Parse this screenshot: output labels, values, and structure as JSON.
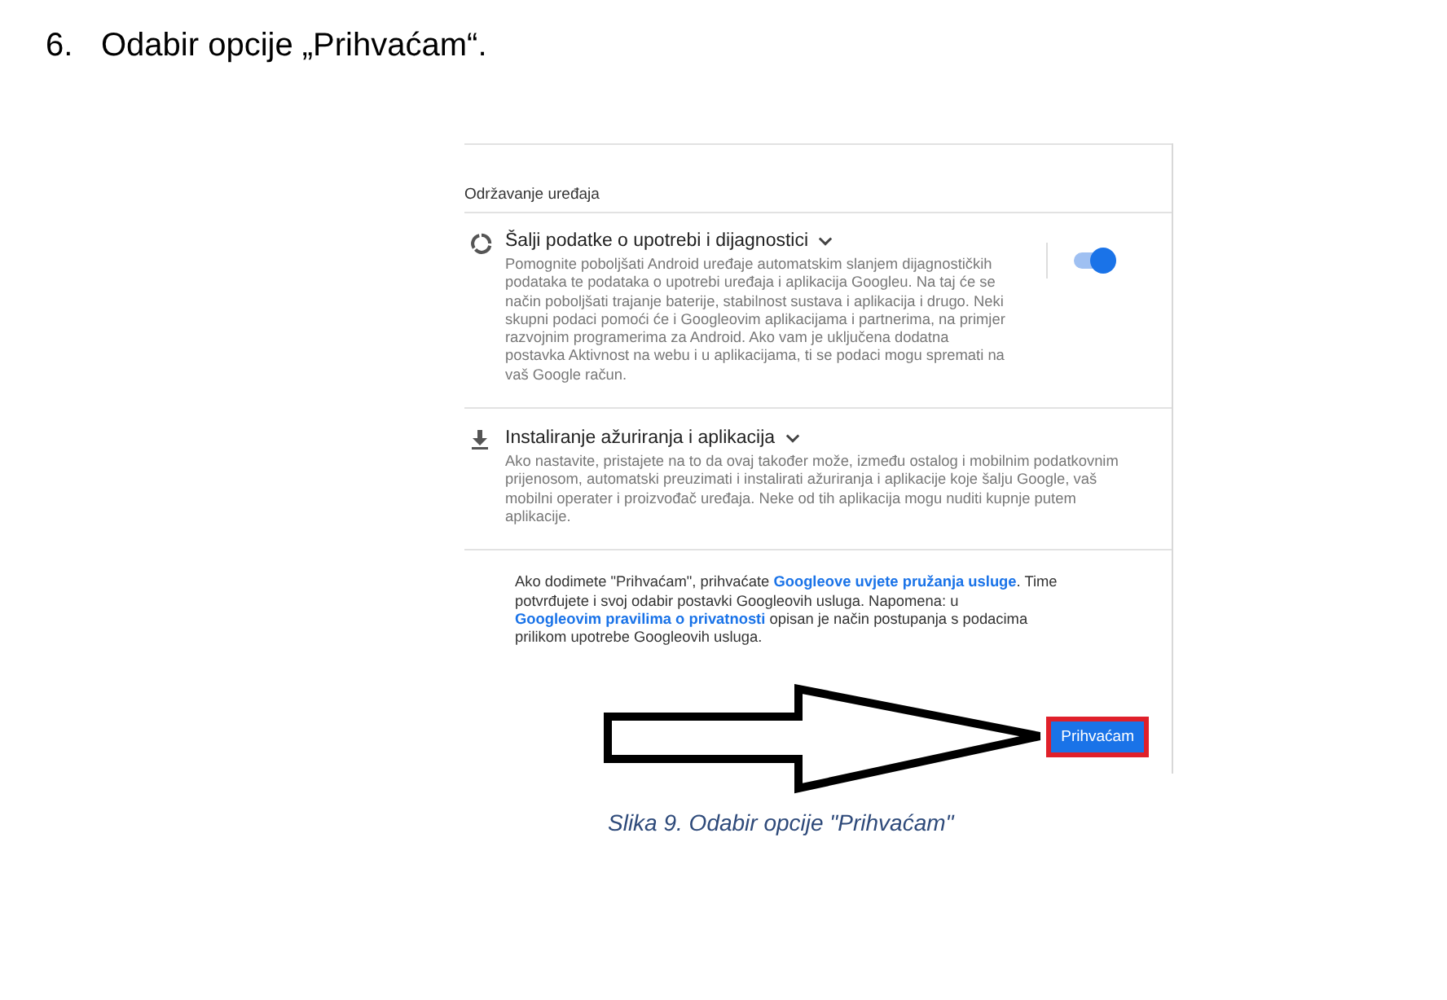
{
  "document": {
    "step_number": "6.",
    "step_text": "Odabir opcije „Prihvaćam“.",
    "caption": "Slika 9. Odabir opcije \"Prihvaćam\""
  },
  "screenshot": {
    "section_title": "Održavanje uređaja",
    "settings": [
      {
        "kind": "toggle",
        "title": "Šalji podatke o upotrebi i dijagnostici",
        "description": "Pomognite poboljšati Android uređaje automatskim slanjem dijagnostičkih podataka te podataka o upotrebi uređaja i aplikacija Googleu. Na taj će se način poboljšati trajanje baterije, stabilnost sustava i aplikacija i drugo. Neki skupni podaci pomoći će i Googleovim aplikacijama i partnerima, na primjer razvojnim programerima za Android. Ako vam je uključena dodatna postavka Aktivnost na webu i u aplikacijama, ti se podaci mogu spremati na vaš Google račun.",
        "on": true
      },
      {
        "kind": "download",
        "title": "Instaliranje ažuriranja i aplikacija",
        "description": "Ako nastavite, pristajete na to da ovaj također može, između ostalog i mobilnim podatkovnim prijenosom, automatski preuzimati i instalirati ažuriranja i aplikacije koje šalju Google, vaš mobilni operater i proizvođač uređaja. Neke od tih aplikacija mogu nuditi kupnje putem aplikacije."
      }
    ],
    "legal_text": [
      {
        "kind": "text",
        "text": "Ako dodimete \"Prihvaćam\", prihvaćate "
      },
      {
        "kind": "link",
        "text": "Googleove uvjete pružanja usluge"
      },
      {
        "kind": "text",
        "text": ". Time potvrđujete i svoj odabir postavki Googleovih usluga. Napomena: u "
      },
      {
        "kind": "link",
        "text": "Googleovim pravilima o privatnosti"
      },
      {
        "kind": "text",
        "text": " opisan je način postupanja s podacima prilikom upotrebe Googleovih usluga."
      }
    ],
    "accept_button": {
      "label": "Prihvaćam",
      "highlighted": true
    }
  }
}
